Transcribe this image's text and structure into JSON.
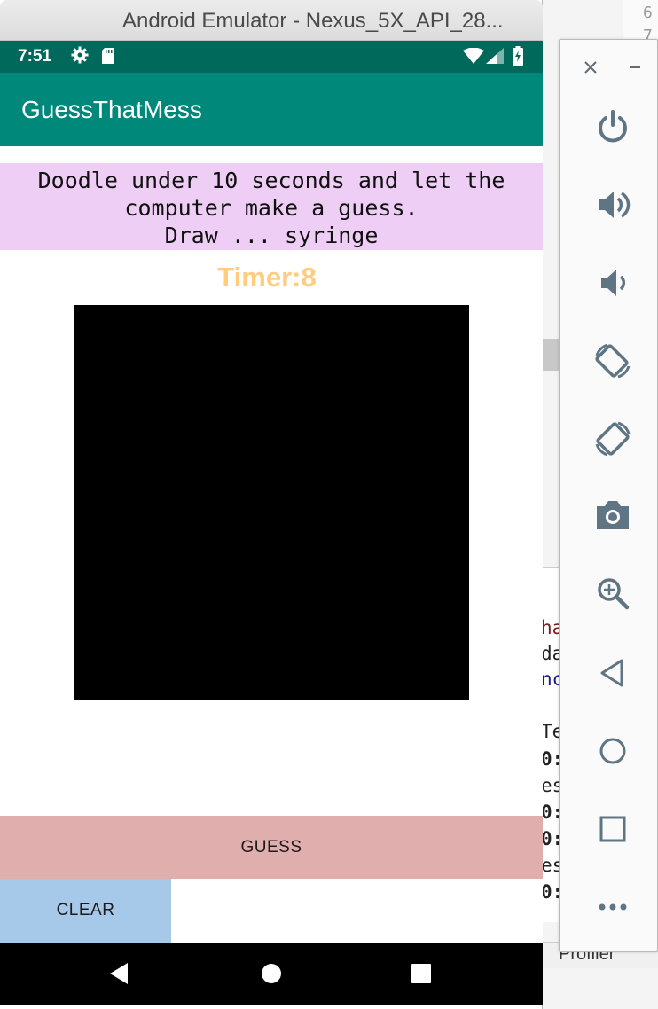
{
  "window": {
    "title": "Android Emulator - Nexus_5X_API_28..."
  },
  "status_bar": {
    "time": "7:51"
  },
  "app_bar": {
    "title": "GuessThatMess"
  },
  "instructions": {
    "line1": "Doodle under 10 seconds and let the",
    "line2": "computer make a guess.",
    "line3": "Draw ... syringe"
  },
  "timer": {
    "label": "Timer:8"
  },
  "buttons": {
    "guess": "GUESS",
    "clear": "CLEAR"
  },
  "colors": {
    "status_bar": "#00695c",
    "app_bar": "#00897b",
    "instructions_bg": "#eecef5",
    "timer": "#ffcc80",
    "canvas": "#000000",
    "guess_bg": "#e1aeae",
    "clear_bg": "#a6c9ea",
    "toolbar_icon": "#5f7583"
  },
  "background_ide": {
    "gutter_numbers": [
      "6",
      "7"
    ],
    "code_fragments": [
      "ha",
      "da",
      "nc",
      "Te",
      "0:",
      "es",
      "0:",
      "0:",
      "es",
      "0:"
    ],
    "bottom_tab": "Profiler"
  },
  "side_toolbar": {
    "icons": [
      "close-icon",
      "minimize-icon",
      "power-icon",
      "volume-up-icon",
      "volume-down-icon",
      "rotate-left-icon",
      "rotate-right-icon",
      "camera-icon",
      "zoom-icon",
      "back-icon",
      "home-icon",
      "overview-icon",
      "more-icon"
    ]
  }
}
